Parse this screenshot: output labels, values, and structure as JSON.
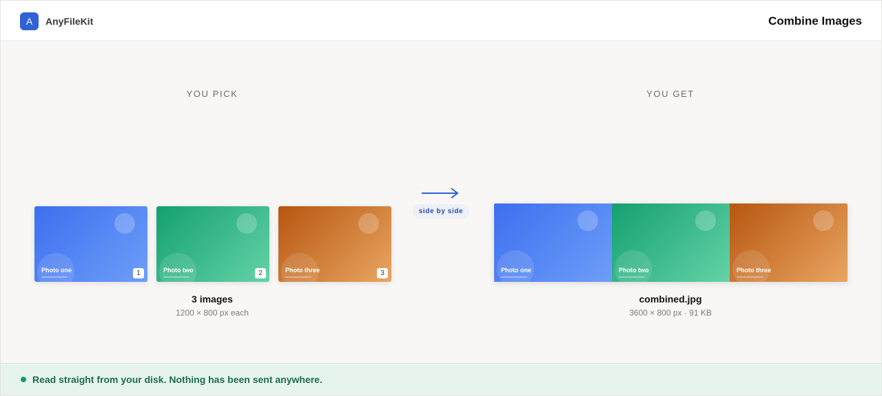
{
  "app": {
    "logo_letter": "A",
    "name": "AnyFileKit"
  },
  "header": {
    "title": "Combine Images"
  },
  "input": {
    "heading": "YOU PICK",
    "images": [
      {
        "label": "Photo one",
        "index": "1",
        "color": "#3d6ff0"
      },
      {
        "label": "Photo two",
        "index": "2",
        "color": "#14a070"
      },
      {
        "label": "Photo three",
        "index": "3",
        "color": "#b75610"
      }
    ],
    "count_label": "3 images",
    "size_label": "1200 × 800 px each"
  },
  "mode": {
    "label": "side by side",
    "arrow_icon": "arrow-right-icon"
  },
  "output": {
    "heading": "YOU GET",
    "segments": [
      {
        "label": "Photo one"
      },
      {
        "label": "Photo two"
      },
      {
        "label": "Photo three"
      }
    ],
    "filename": "combined.jpg",
    "details": "3600 × 800 px · 91 KB"
  },
  "footer": {
    "status_text": "Read straight from your disk. Nothing has been sent anywhere.",
    "status_color": "#139a60"
  },
  "colors": {
    "accent": "#2f62d6",
    "blue": "#3d6ff0",
    "green": "#14a070",
    "orange": "#b75610"
  }
}
